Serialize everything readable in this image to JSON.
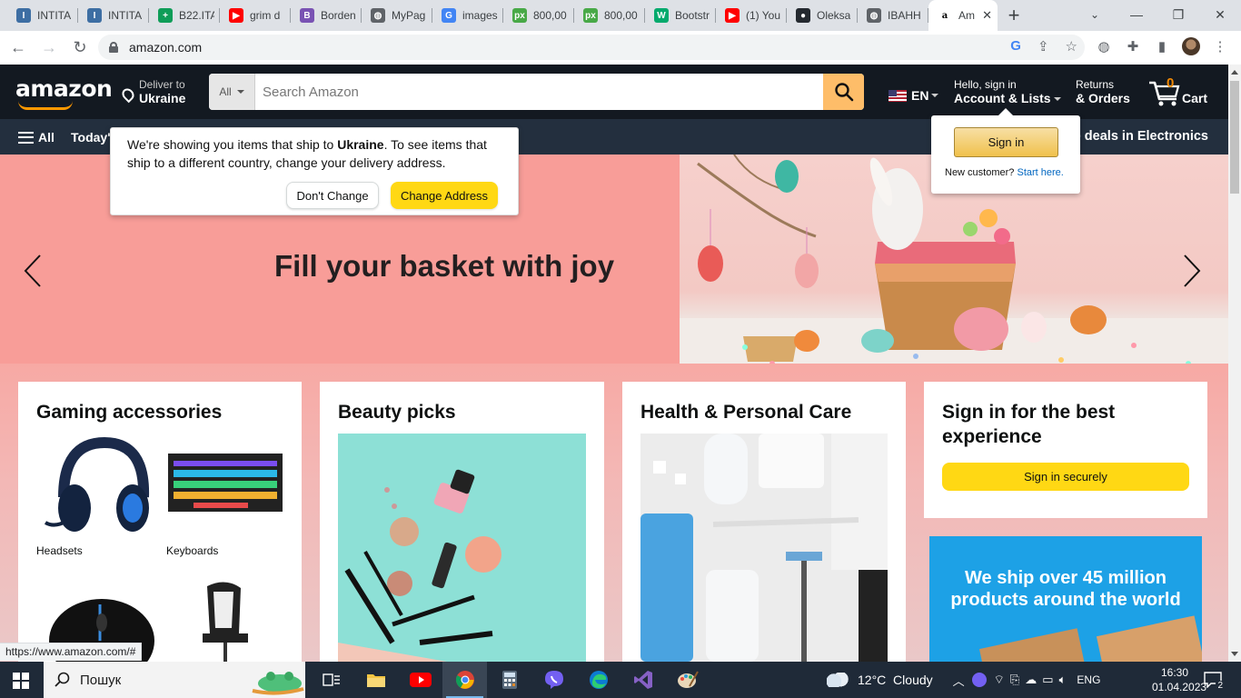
{
  "browser": {
    "tabs": [
      {
        "title": "INTITA",
        "icon": "intita-icon",
        "color": "#3d6ea3",
        "glyph": "I"
      },
      {
        "title": "INTITA",
        "icon": "intita-icon",
        "color": "#3d6ea3",
        "glyph": "I"
      },
      {
        "title": "B22.ITA",
        "icon": "sheets-icon",
        "color": "#0f9d58",
        "glyph": "+"
      },
      {
        "title": "grim d",
        "icon": "youtube-icon",
        "color": "#ff0000",
        "glyph": "▶"
      },
      {
        "title": "Borden",
        "icon": "bootstrap-icon",
        "color": "#7952b3",
        "glyph": "B"
      },
      {
        "title": "MyPag",
        "icon": "globe-icon",
        "color": "#5f6368",
        "glyph": "◍"
      },
      {
        "title": "images",
        "icon": "google-icon",
        "color": "#4285f4",
        "glyph": "G"
      },
      {
        "title": "800,00",
        "icon": "pixabay-icon",
        "color": "#48a947",
        "glyph": "px"
      },
      {
        "title": "800,00",
        "icon": "pixabay-icon",
        "color": "#48a947",
        "glyph": "px"
      },
      {
        "title": "Bootstr",
        "icon": "w3-icon",
        "color": "#04aa6d",
        "glyph": "W"
      },
      {
        "title": "(1) You",
        "icon": "youtube-icon",
        "color": "#ff0000",
        "glyph": "▶"
      },
      {
        "title": "Oleksa",
        "icon": "github-icon",
        "color": "#24292f",
        "glyph": "●"
      },
      {
        "title": "IBAHH",
        "icon": "globe-icon",
        "color": "#5f6368",
        "glyph": "◍"
      }
    ],
    "active_tab": {
      "title": "Am",
      "icon": "amazon-icon",
      "glyph": "a"
    },
    "new_tab": "+",
    "url": "amazon.com",
    "status_url": "https://www.amazon.com/#"
  },
  "amazon": {
    "logo": "amazon",
    "deliver_line1": "Deliver to",
    "deliver_line2": "Ukraine",
    "search_category": "All",
    "search_placeholder": "Search Amazon",
    "language": "EN",
    "account_line1": "Hello, sign in",
    "account_line2": "Account & Lists",
    "returns_line1": "Returns",
    "returns_line2": "& Orders",
    "cart_count": "0",
    "cart_label": "Cart",
    "subnav_all": "All",
    "subnav_today": "Today's",
    "subnav_deals": "p deals in Electronics",
    "hero_title": "Fill your basket with joy",
    "location_popover": {
      "text_before": "We're showing you items that ship to ",
      "country": "Ukraine",
      "text_after": ". To see items that ship to a different country, change your delivery address.",
      "dont_change": "Don't Change",
      "change_address": "Change Address"
    },
    "signin_flyout": {
      "button": "Sign in",
      "new_customer": "New customer?",
      "start_here": "Start here."
    },
    "cards": {
      "gaming": {
        "title": "Gaming accessories",
        "items": [
          "Headsets",
          "Keyboards"
        ]
      },
      "beauty": {
        "title": "Beauty picks"
      },
      "health": {
        "title": "Health & Personal Care"
      },
      "signin": {
        "title": "Sign in for the best experience",
        "button": "Sign in securely"
      },
      "ship_banner": "We ship over 45 million products around the world"
    }
  },
  "taskbar": {
    "search_placeholder": "Пошук",
    "weather": "12°C  Cloudy",
    "language": "ENG",
    "time": "16:30",
    "date": "01.04.2023",
    "notifications": "2"
  },
  "colors": {
    "amazon_nav": "#131921",
    "amazon_subnav": "#232f3e",
    "search_button": "#febd69",
    "hero_bg": "#f89d98",
    "button_yellow": "#ffd814",
    "ship_banner": "#1da1e6"
  }
}
